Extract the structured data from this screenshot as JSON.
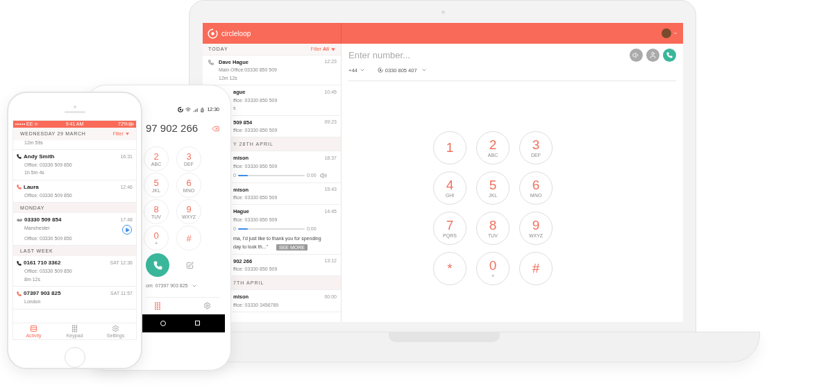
{
  "laptop": {
    "brand": "circle**loop**",
    "list_header": {
      "title": "TODAY",
      "filter": "Filter **All**"
    },
    "items": [
      {
        "kind": "call",
        "name": "Dave Hague",
        "time": "12:23",
        "line": "Main Office:03330 850 509",
        "duration": "12m 12s"
      },
      {
        "kind": "call",
        "name": "ague",
        "time": "10:45",
        "line": "ffice: 03330 850 509",
        "duration": "s"
      },
      {
        "kind": "call",
        "name": "509 854",
        "time": "09:23",
        "line": "ffice: 03330 850 509"
      },
      {
        "kind": "section",
        "title": "Y 28TH APRIL"
      },
      {
        "kind": "voicemail",
        "name": "mison",
        "time": "18:37",
        "line": "ffice: 03330 850 509",
        "start": "0",
        "end": "0:00",
        "level": 0.15,
        "volume": true
      },
      {
        "kind": "call",
        "name": "mison",
        "time": "15:43",
        "line": "ffice: 03330 850 509"
      },
      {
        "kind": "voicemail",
        "name": "Hague",
        "time": "14:45",
        "line": "ffice: 03330 850 509",
        "start": "0",
        "end": "0:00",
        "level": 0.15,
        "volume": false,
        "transcript": [
          "ma, I'd just like to thank you for spending",
          "day to look th...\""
        ],
        "more": "SEE MORE"
      },
      {
        "kind": "call",
        "name": "902 266",
        "time": "13:12",
        "line": "ffice: 03330 850 509"
      },
      {
        "kind": "section",
        "title": "7TH APRIL"
      },
      {
        "kind": "call",
        "name": "mison",
        "time": "00:00",
        "line": "ffice: 03330 3456789"
      }
    ],
    "dialer": {
      "placeholder": "Enter number...",
      "country_code": "+44",
      "caller_id": "0330 805 407",
      "keys": [
        {
          "digit": "1"
        },
        {
          "digit": "2",
          "letters": "ABC"
        },
        {
          "digit": "3",
          "letters": "DEF"
        },
        {
          "digit": "4",
          "letters": "GHI"
        },
        {
          "digit": "5",
          "letters": "JKL"
        },
        {
          "digit": "6",
          "letters": "MNO"
        },
        {
          "digit": "7",
          "letters": "PQRS"
        },
        {
          "digit": "8",
          "letters": "TUV"
        },
        {
          "digit": "9",
          "letters": "WXYZ"
        },
        {
          "digit": "*"
        },
        {
          "digit": "0",
          "letters": "+"
        },
        {
          "digit": "#"
        }
      ]
    }
  },
  "android": {
    "time": "12:30",
    "number": "97 902 266",
    "keys": [
      {
        "digit": "2",
        "letters": "ABC"
      },
      {
        "digit": "3",
        "letters": "DEF"
      },
      {
        "digit": "5",
        "letters": "JKL"
      },
      {
        "digit": "6",
        "letters": "MNO"
      },
      {
        "digit": "8",
        "letters": "TUV"
      },
      {
        "digit": "9",
        "letters": "WXYZ"
      },
      {
        "digit": "0",
        "letters": "+"
      },
      {
        "digit": "#"
      }
    ],
    "from_label": "om",
    "from_number": "07397 903 825"
  },
  "iphone": {
    "carrier": "EE",
    "time": "9:41 AM",
    "battery": "72%",
    "header": "WEDNESDAY 29 MARCH",
    "filter": "Filter",
    "items": [
      {
        "kind": "partial",
        "duration": "12m 59s"
      },
      {
        "kind": "call",
        "name": "Andy Smith",
        "time": "16:31",
        "missed": false,
        "line": "Office: 03330 509 850",
        "duration": "1h 5m 4s"
      },
      {
        "kind": "call",
        "name": "Laura",
        "time": "12:46",
        "missed": true,
        "line": "Office: 03330 509 850"
      },
      {
        "kind": "section",
        "title": "MONDAY"
      },
      {
        "kind": "voicemail",
        "name": "03330 509 854",
        "time": "17:48",
        "place": "Manchester",
        "line": "Office: 03330 509 850"
      },
      {
        "kind": "section",
        "title": "LAST WEEK"
      },
      {
        "kind": "call",
        "name": "0161 710 3362",
        "time": "SAT 12:36",
        "missed": false,
        "line": "Office: 03330 509 850",
        "duration": "8m 12s"
      },
      {
        "kind": "call",
        "name": "07397 903 825",
        "time": "SAT 11:57",
        "missed": true,
        "place": "London"
      }
    ],
    "tabs": [
      {
        "label": "Activity",
        "selected": true
      },
      {
        "label": "Keypad",
        "selected": false
      },
      {
        "label": "Settings",
        "selected": false
      }
    ]
  }
}
